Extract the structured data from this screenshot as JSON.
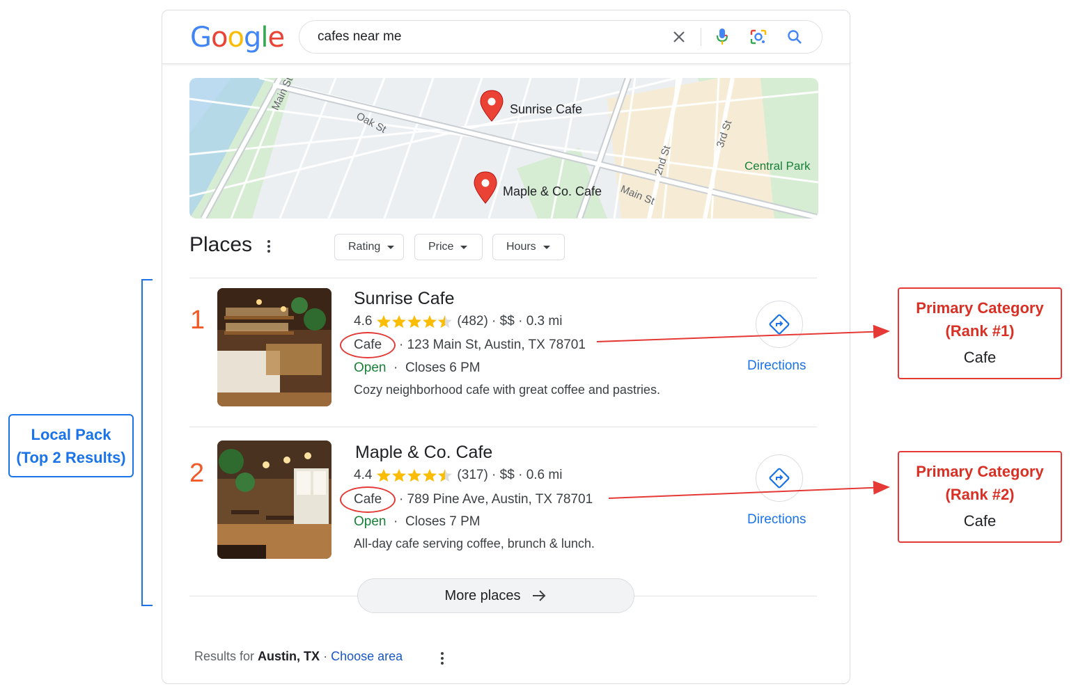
{
  "search": {
    "logo_letters": [
      "G",
      "o",
      "o",
      "g",
      "l",
      "e"
    ],
    "query": "cafes near me"
  },
  "map": {
    "pins": [
      "Sunrise Cafe",
      "Maple & Co. Cafe"
    ],
    "streets": [
      "Main St",
      "Oak St",
      "2nd St",
      "3rd St",
      "Main St"
    ],
    "park": "Central Park"
  },
  "places": {
    "title": "Places",
    "filters": [
      "Rating",
      "Price",
      "Hours"
    ]
  },
  "results": [
    {
      "rank": "1",
      "name": "Sunrise Cafe",
      "rating": "4.6",
      "stars": 4.5,
      "reviews": "(482)",
      "price": "$$",
      "distance": "0.3 mi",
      "category": "Cafe",
      "address": "123 Main St, Austin, TX 78701",
      "status": "Open",
      "hours": "Closes 6 PM",
      "description": "Cozy neighborhood cafe with great coffee and pastries.",
      "directions": "Directions"
    },
    {
      "rank": "2",
      "name": "Maple & Co. Cafe",
      "rating": "4.4",
      "stars": 4.5,
      "reviews": "(317)",
      "price": "$$",
      "distance": "0.6 mi",
      "category": "Cafe",
      "address": "789 Pine Ave, Austin, TX 78701",
      "status": "Open",
      "hours": "Closes 7 PM",
      "description": "All-day cafe serving coffee, brunch & lunch.",
      "directions": "Directions"
    }
  ],
  "more_places": "More places",
  "footer": {
    "prefix": "Results for",
    "location": "Austin, TX",
    "separator": "·",
    "choose_area": "Choose area"
  },
  "annotations": {
    "local_pack_line1": "Local Pack",
    "local_pack_line2": "(Top 2 Results)",
    "boxes": [
      {
        "line1": "Primary Category",
        "line2": "(Rank #1)",
        "value": "Cafe"
      },
      {
        "line1": "Primary Category",
        "line2": "(Rank #2)",
        "value": "Cafe"
      }
    ]
  },
  "colors": {
    "accent_blue": "#1a73e8",
    "annotation_red": "#e53935",
    "rank_orange": "#f05a28",
    "open_green": "#188038",
    "star_yellow": "#fbbc04"
  }
}
